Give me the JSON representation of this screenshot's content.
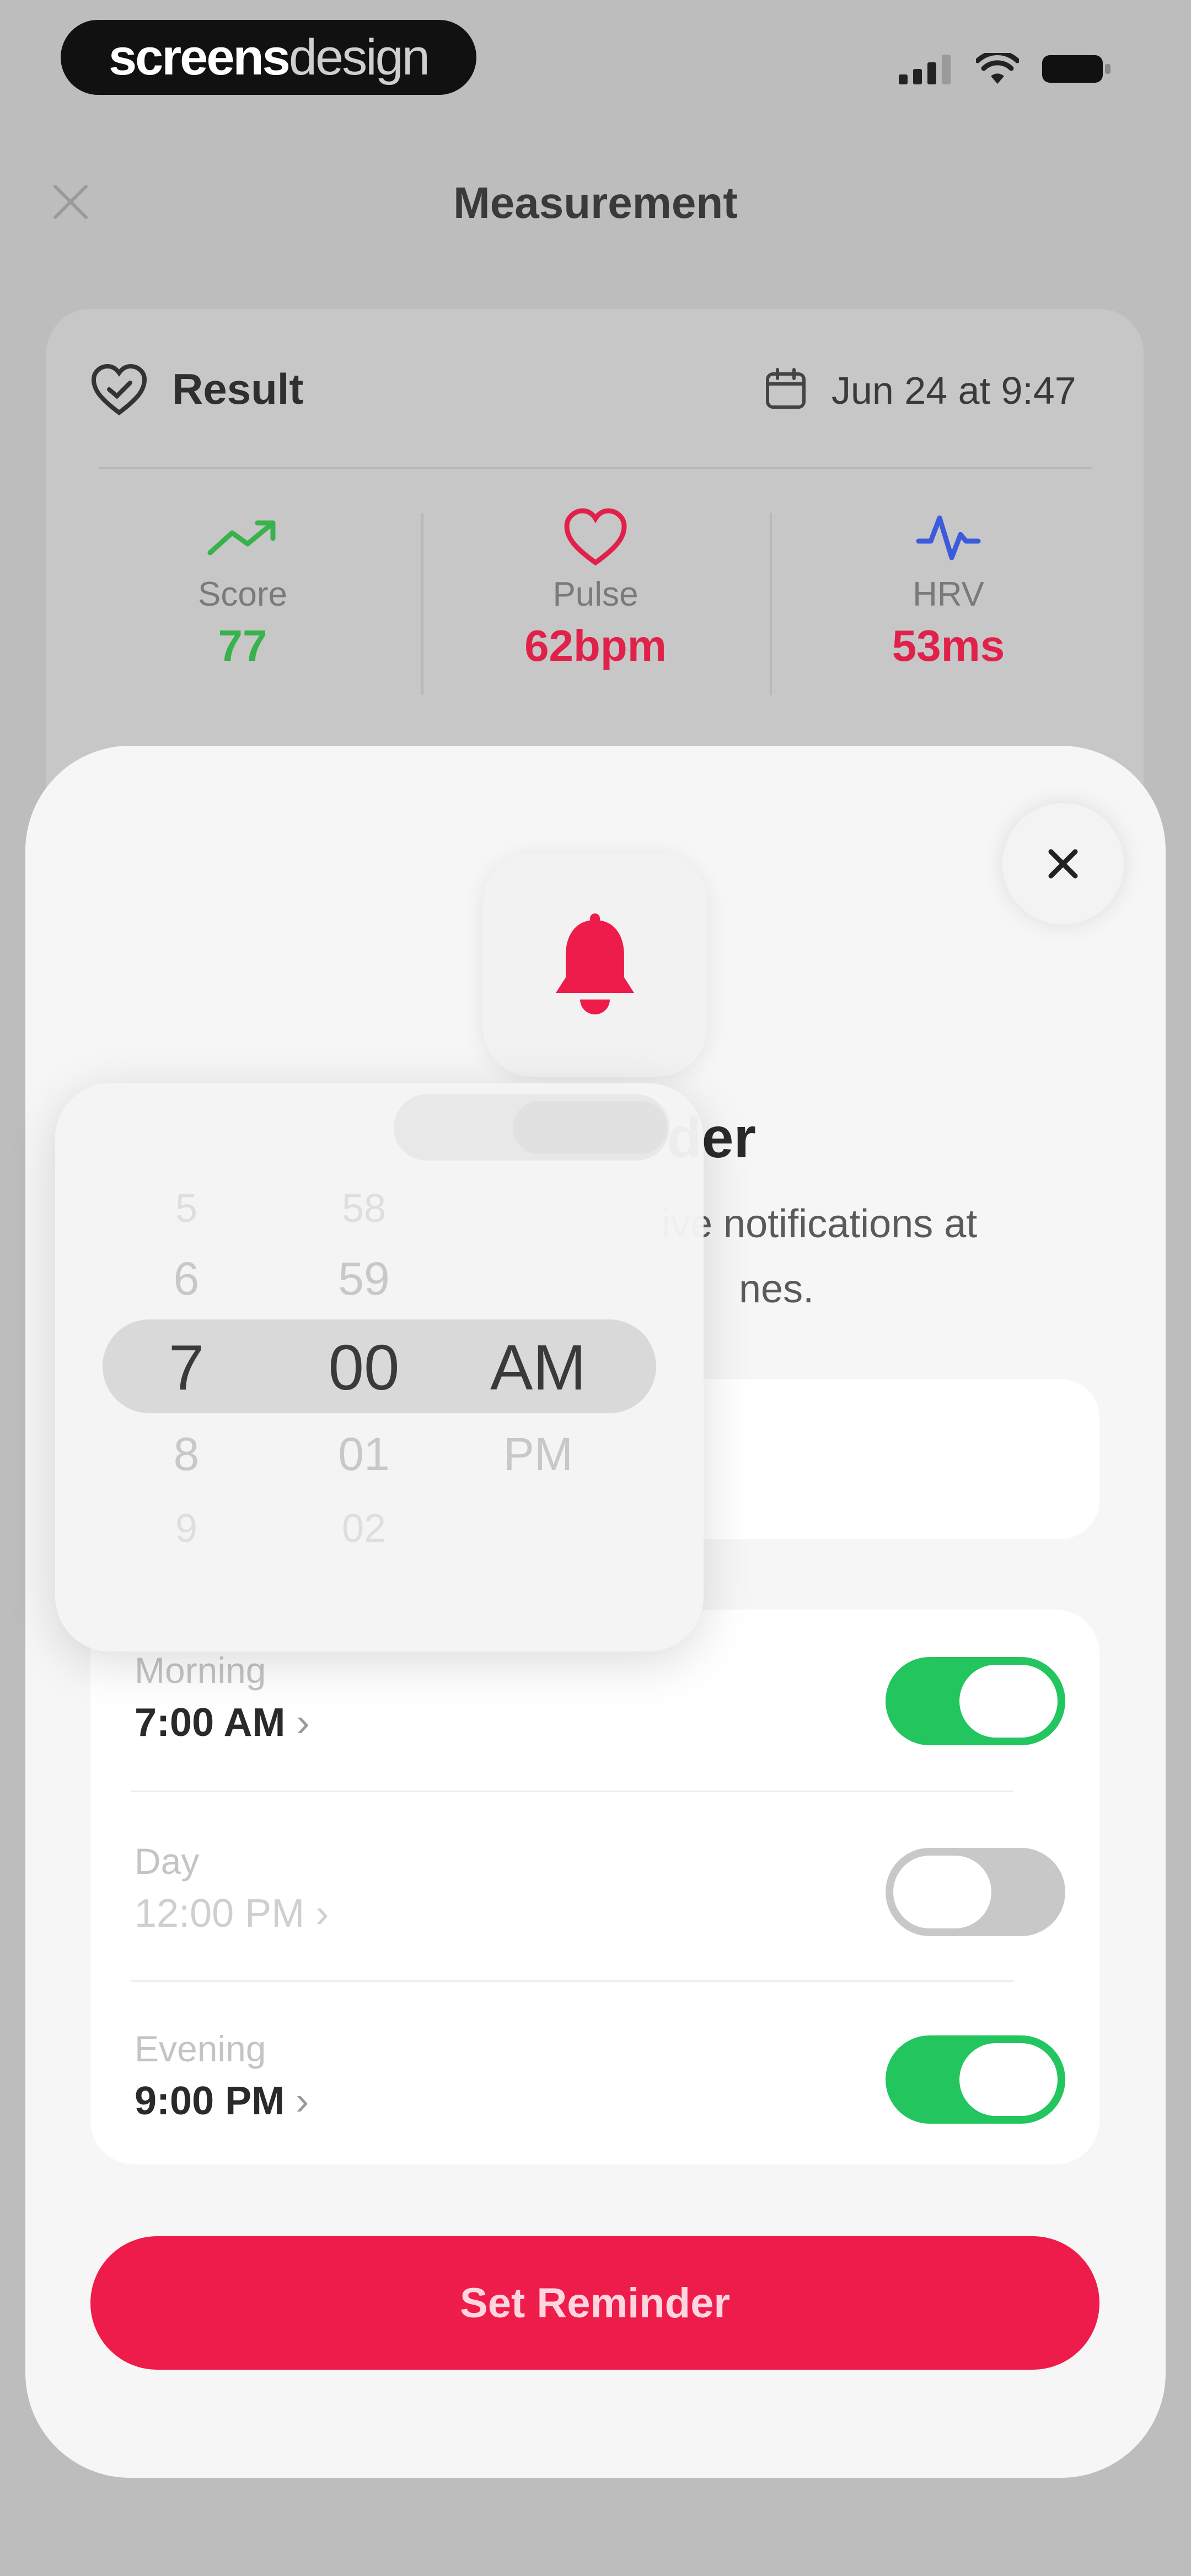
{
  "status_bar": {
    "brand_bold": "screens",
    "brand_light": "design",
    "icons": [
      "signal-icon",
      "wifi-icon",
      "battery-icon"
    ]
  },
  "header": {
    "title": "Measurement"
  },
  "result": {
    "title": "Result",
    "date": "Jun 24 at 9:47",
    "metrics": [
      {
        "label": "Score",
        "value": "77",
        "color": "#38b24c",
        "icon": "trend-up-icon"
      },
      {
        "label": "Pulse",
        "value": "62bpm",
        "color": "#e0224a",
        "icon": "heart-icon"
      },
      {
        "label": "HRV",
        "value": "53ms",
        "color": "#e0224a",
        "icon": "pulse-wave-icon"
      }
    ]
  },
  "sheet": {
    "title_visible": "der",
    "description_line1": "ive notifications at",
    "description_line2": "nes.",
    "schedule": [
      {
        "label": "Morning",
        "time": "7:00 AM",
        "enabled": true
      },
      {
        "label": "Day",
        "time": "12:00 PM",
        "enabled": false
      },
      {
        "label": "Evening",
        "time": "9:00 PM",
        "enabled": true
      }
    ],
    "cta_label": "Set Reminder",
    "accent": "#ee1c4a",
    "toggle_on_color": "#22c55e"
  },
  "time_picker": {
    "hours": [
      "5",
      "6",
      "7",
      "8",
      "9"
    ],
    "minutes": [
      "58",
      "59",
      "00",
      "01",
      "02"
    ],
    "periods": [
      "AM",
      "PM"
    ]
  }
}
